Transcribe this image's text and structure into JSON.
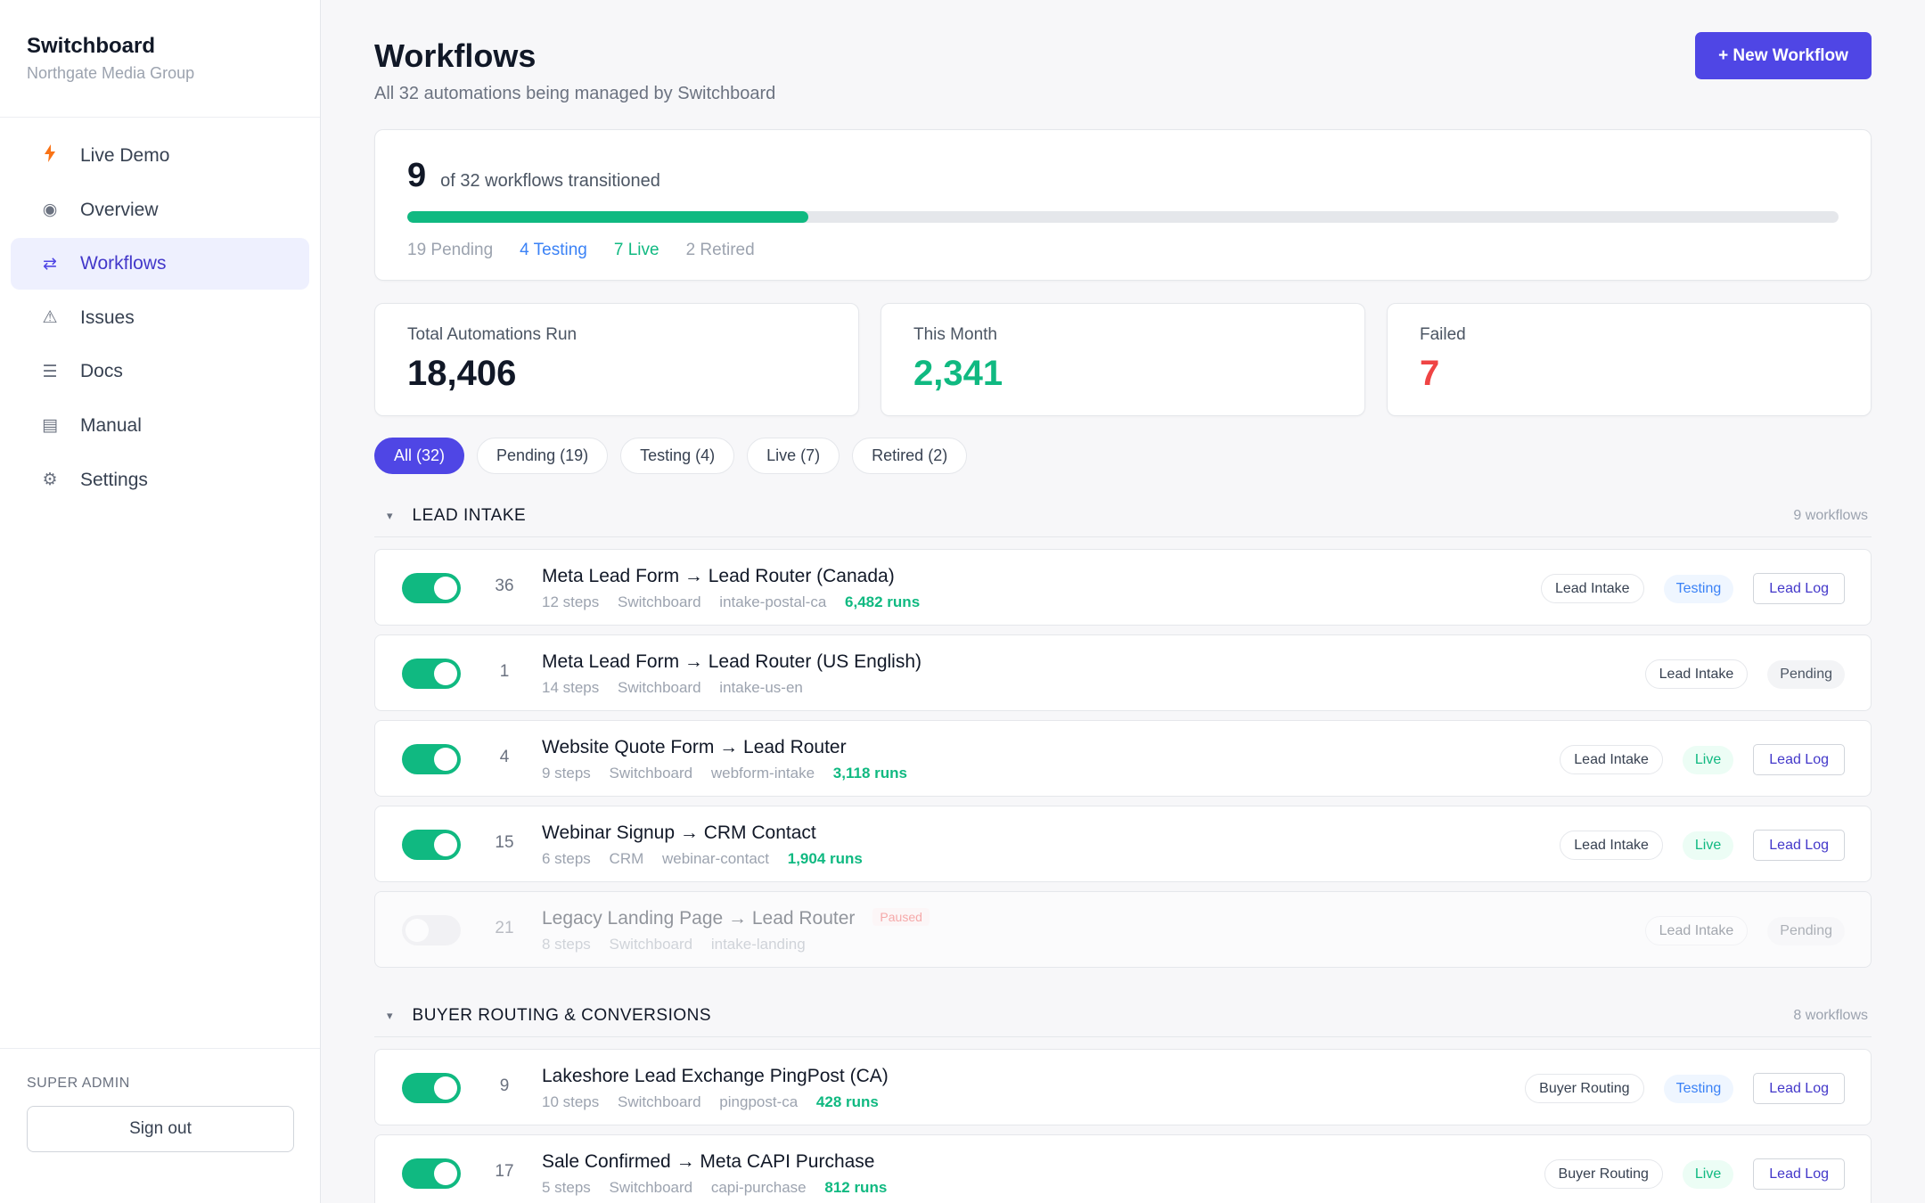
{
  "sidebar": {
    "brand_name": "Switchboard",
    "brand_org": "Northgate Media Group",
    "items": [
      {
        "label": "Live Demo",
        "icon": "bolt-icon"
      },
      {
        "label": "Overview",
        "icon": "radio-icon"
      },
      {
        "label": "Workflows",
        "icon": "swap-arrows-icon",
        "active": true
      },
      {
        "label": "Issues",
        "icon": "warning-icon"
      },
      {
        "label": "Docs",
        "icon": "list-icon"
      },
      {
        "label": "Manual",
        "icon": "book-icon"
      },
      {
        "label": "Settings",
        "icon": "gear-icon"
      }
    ],
    "role": "SUPER ADMIN",
    "signout_label": "Sign out"
  },
  "header": {
    "title": "Workflows",
    "subtitle": "All 32 automations being managed by Switchboard",
    "new_button": "+ New Workflow"
  },
  "progress": {
    "count": "9",
    "text": "of 32 workflows transitioned",
    "fraction": 0.28,
    "pending": "19 Pending",
    "testing": "4 Testing",
    "live": "7 Live",
    "retired": "2 Retired"
  },
  "stats": [
    {
      "label": "Total Automations Run",
      "value": "18,406",
      "color": "#111827"
    },
    {
      "label": "This Month",
      "value": "2,341",
      "color": "#10b981"
    },
    {
      "label": "Failed",
      "value": "7",
      "color": "#ef4444"
    }
  ],
  "filters": [
    "All (32)",
    "Pending (19)",
    "Testing (4)",
    "Live (7)",
    "Retired (2)"
  ],
  "sections": [
    {
      "title": "LEAD INTAKE",
      "count": "9 workflows",
      "rows": [
        {
          "num": "36",
          "title": "Meta Lead Form → Lead Router (Canada)",
          "steps": "12 steps",
          "source": "Switchboard",
          "slug": "intake-postal-ca",
          "runs": "6,482 runs",
          "tag": "Lead Intake",
          "status": "Testing",
          "log": "Lead Log",
          "enabled": true
        },
        {
          "num": "1",
          "title": "Meta Lead Form → Lead Router (US English)",
          "steps": "14 steps",
          "source": "Switchboard",
          "slug": "intake-us-en",
          "runs": "",
          "tag": "Lead Intake",
          "status": "Pending",
          "log": "",
          "enabled": true
        },
        {
          "num": "4",
          "title": "Website Quote Form → Lead Router",
          "steps": "9 steps",
          "source": "Switchboard",
          "slug": "webform-intake",
          "runs": "3,118 runs",
          "tag": "Lead Intake",
          "status": "Live",
          "log": "Lead Log",
          "enabled": true
        },
        {
          "num": "15",
          "title": "Webinar Signup → CRM Contact",
          "steps": "6 steps",
          "source": "CRM",
          "slug": "webinar-contact",
          "runs": "1,904 runs",
          "tag": "Lead Intake",
          "status": "Live",
          "log": "Lead Log",
          "enabled": true
        },
        {
          "num": "21",
          "title": "Legacy Landing Page → Lead Router",
          "paused": "Paused",
          "steps": "8 steps",
          "source": "Switchboard",
          "slug": "intake-landing",
          "runs": "",
          "tag": "Lead Intake",
          "status": "Pending",
          "log": "",
          "enabled": false
        }
      ]
    },
    {
      "title": "BUYER ROUTING & CONVERSIONS",
      "count": "8 workflows",
      "rows": [
        {
          "num": "9",
          "title": "Lakeshore Lead Exchange PingPost (CA)",
          "steps": "10 steps",
          "source": "Switchboard",
          "slug": "pingpost-ca",
          "runs": "428 runs",
          "tag": "Buyer Routing",
          "status": "Testing",
          "log": "Lead Log",
          "enabled": true
        },
        {
          "num": "17",
          "title": "Sale Confirmed → Meta CAPI Purchase",
          "steps": "5 steps",
          "source": "Switchboard",
          "slug": "capi-purchase",
          "runs": "812 runs",
          "tag": "Buyer Routing",
          "status": "Live",
          "log": "Lead Log",
          "enabled": true
        }
      ]
    }
  ]
}
